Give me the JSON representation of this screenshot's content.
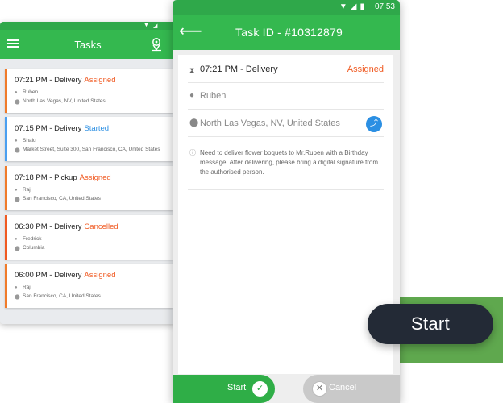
{
  "colors": {
    "brand_green": "#34b84f",
    "assigned": "#f05a22",
    "started": "#2b8fe3",
    "cancelled": "#f05a22",
    "dark_pill": "#232a36"
  },
  "floating_button": {
    "label": "Start"
  },
  "back_phone": {
    "title": "Tasks",
    "tasks": [
      {
        "time_type": "07:21 PM - Delivery",
        "status": "Assigned",
        "status_color": "#f05a22",
        "border_color": "#f07b2a",
        "name": "Ruben",
        "address": "North Las Vegas, NV, United States"
      },
      {
        "time_type": "07:15 PM - Delivery",
        "status": "Started",
        "status_color": "#2b8fe3",
        "border_color": "#4a9ff0",
        "name": "Shalu",
        "address": "Market Street, Suite 300, San Francisco, CA, United States"
      },
      {
        "time_type": "07:18 PM - Pickup",
        "status": "Assigned",
        "status_color": "#f05a22",
        "border_color": "#f07b2a",
        "name": "Raj",
        "address": "San Francisco, CA, United States"
      },
      {
        "time_type": "06:30 PM - Delivery",
        "status": "Cancelled",
        "status_color": "#f05a22",
        "border_color": "#f05a22",
        "name": "Fredrick",
        "address": "Columbia"
      },
      {
        "time_type": "06:00 PM - Delivery",
        "status": "Assigned",
        "status_color": "#f05a22",
        "border_color": "#f07b2a",
        "name": "Raj",
        "address": "San Francisco, CA, United States"
      }
    ]
  },
  "front_phone": {
    "status_time": "07:53",
    "title": "Task ID - #10312879",
    "detail": {
      "time_type": "07:21 PM - Delivery",
      "status": "Assigned",
      "name": "Ruben",
      "address": "North Las Vegas, NV, United States",
      "note": "Need to deliver flower boquets to Mr.Ruben with a Birthday message. After delivering, please bring a digital signature from the authorised person."
    },
    "start_label": "Start",
    "cancel_label": "Cancel"
  }
}
